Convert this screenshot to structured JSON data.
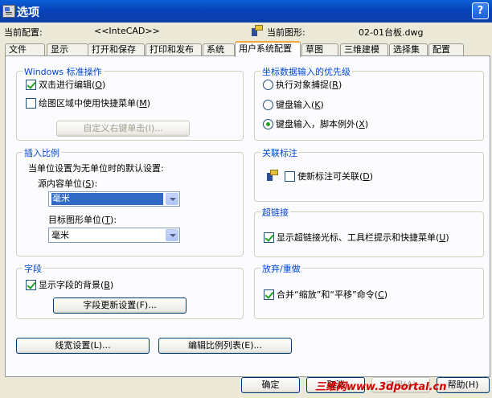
{
  "window": {
    "title": "选项",
    "help_glyph": "?"
  },
  "config": {
    "profile_label": "当前配置:",
    "profile_value": "<<InteCAD>>",
    "drawing_label": "当前图形:",
    "drawing_value": "02-01台板.dwg"
  },
  "tabs": [
    {
      "label": "文件"
    },
    {
      "label": "显示"
    },
    {
      "label": "打开和保存"
    },
    {
      "label": "打印和发布"
    },
    {
      "label": "系统"
    },
    {
      "label": "用户系统配置",
      "active": true
    },
    {
      "label": "草图"
    },
    {
      "label": "三维建模"
    },
    {
      "label": "选择集"
    },
    {
      "label": "配置"
    }
  ],
  "windows_ops": {
    "title": "Windows 标准操作",
    "double_click_edit": {
      "label": "双击进行编辑(",
      "key": "O",
      "tail": ")",
      "checked": true
    },
    "shortcut_menu": {
      "label": "绘图区域中使用快捷菜单(",
      "key": "M",
      "tail": ")",
      "checked": false
    },
    "custom_right_click": "自定义右键单击(I)..."
  },
  "insert_scale": {
    "title": "插入比例",
    "description": "当单位设置为无单位时的默认设置:",
    "source_label": "源内容单位(",
    "source_key": "S",
    "source_tail": "):",
    "source_value": "毫米",
    "target_label": "目标图形单位(",
    "target_key": "T",
    "target_tail": "):",
    "target_value": "毫米"
  },
  "fields": {
    "title": "字段",
    "show_background": {
      "label": "显示字段的背景(",
      "key": "B",
      "tail": ")",
      "checked": true
    },
    "update_settings": "字段更新设置(F)..."
  },
  "coord_priority": {
    "title": "坐标数据输入的优先级",
    "options": [
      {
        "label": "执行对象捕捉(",
        "key": "R",
        "tail": ")",
        "selected": false
      },
      {
        "label": "键盘输入(",
        "key": "K",
        "tail": ")",
        "selected": false
      },
      {
        "label": "键盘输入，脚本例外(",
        "key": "X",
        "tail": ")",
        "selected": true
      }
    ]
  },
  "assoc_dim": {
    "title": "关联标注",
    "make_assoc": {
      "label": "使新标注可关联(",
      "key": "D",
      "tail": ")",
      "checked": false
    }
  },
  "hyperlink": {
    "title": "超链接",
    "show_cursor": {
      "label": "显示超链接光标、工具栏提示和快捷菜单(",
      "key": "U",
      "tail": ")",
      "checked": true
    }
  },
  "undo_redo": {
    "title": "放弃/重做",
    "combine": {
      "label": "合并“缩放”和“平移”命令(",
      "key": "C",
      "tail": ")",
      "checked": true
    }
  },
  "bottom_buttons": {
    "lineweight": "线宽设置(L)...",
    "scale_list": "编辑比例列表(E)..."
  },
  "dialog_buttons": {
    "ok": "确定",
    "cancel": "取消",
    "apply": "应用(A)",
    "help": "帮助(H)"
  },
  "watermark": "三维网www.3dportal.cn"
}
